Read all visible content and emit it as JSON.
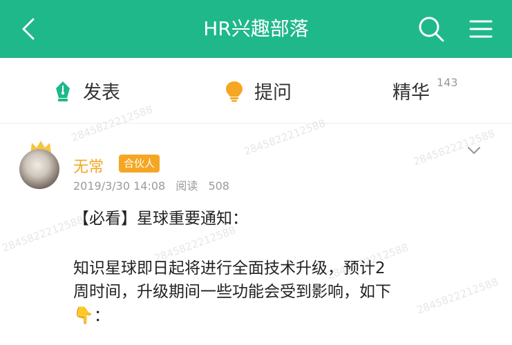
{
  "header": {
    "title": "HR兴趣部落",
    "bg_color": "#1fb88a",
    "icons": {
      "back": "back-arrow-icon",
      "search": "search-icon",
      "menu": "hamburger-menu-icon"
    }
  },
  "tabs": [
    {
      "label": "发表",
      "icon": "pen-nib-icon"
    },
    {
      "label": "提问",
      "icon": "lightbulb-icon"
    },
    {
      "label": "精华",
      "count": "143"
    }
  ],
  "watermark_text": "2845822212588",
  "post": {
    "author": "无常",
    "role_badge": "合伙人",
    "timestamp": "2019/3/30 14:08",
    "reads_label": "阅读",
    "reads_count": "508",
    "title": "【必看】星球重要通知：",
    "body_line1": "知识星球即日起将进行全面技术升级，预计2",
    "body_line2": "周时间，升级期间一些功能会受到影响，如下",
    "body_line3": "：",
    "body_emoji": "👇"
  },
  "colors": {
    "accent": "#1fb88a",
    "author": "#f5a623",
    "badge": "#f5a623",
    "pen": "#1fb88a",
    "bulb": "#f5a623"
  }
}
